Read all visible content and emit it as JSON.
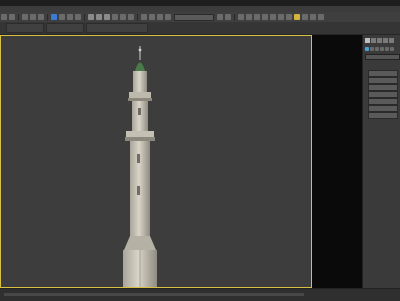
{
  "window": {
    "title": ""
  },
  "menu": {
    "items": [
      "",
      "",
      "",
      "",
      "",
      "",
      "",
      "",
      "",
      "",
      "",
      "",
      "",
      ""
    ]
  },
  "command_panel": {
    "rollout_object_type": "",
    "rollout_name_and_color": "",
    "object_buttons": [
      "",
      "",
      "",
      "",
      "",
      "",
      ""
    ]
  },
  "colors": {
    "viewport_border": "#d8c040",
    "viewport_bg": "#3d3d3d",
    "accent": "#4aa3d8"
  }
}
